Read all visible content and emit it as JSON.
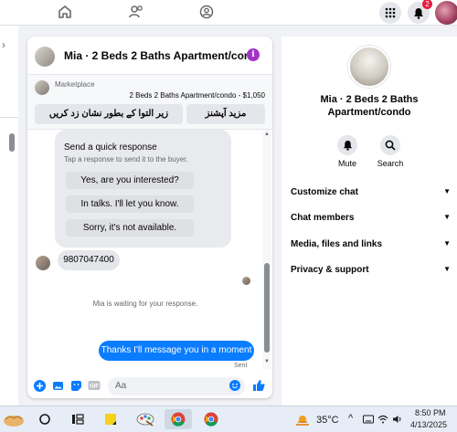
{
  "chat": {
    "title": "Mia · 2 Beds 2 Baths Apartment/condo...",
    "info_icon": "i",
    "marketplace": {
      "label": "Marketplace",
      "item": "2 Beds 2 Baths Apartment/condo - $1,050",
      "btn_more": "مزید آپشنز",
      "btn_pending": "زیر التوا کے بطور نشان زد کریں"
    },
    "quick_response": {
      "title": "Send a quick response",
      "subtitle": "Tap a response to send it to the buyer.",
      "options": [
        "Yes, are you interested?",
        "In talks. I'll let you know.",
        "Sorry, it's not available."
      ]
    },
    "incoming_message": "9807047400",
    "waiting_text": "Mia is waiting for your response.",
    "outgoing_message": "Thanks I'll message you in a moment",
    "sent_status": "Sent",
    "composer_placeholder": "Aa"
  },
  "details": {
    "name": "Mia · 2 Beds 2 Baths Apartment/condo",
    "actions": [
      "Mute",
      "Search"
    ],
    "sections": [
      "Customize chat",
      "Chat members",
      "Media, files and links",
      "Privacy & support"
    ]
  },
  "nav": {
    "notification_count": "2"
  },
  "taskbar": {
    "temperature": "35°C",
    "time": "8:50 PM",
    "date": "4/13/2025"
  },
  "colors": {
    "accent": "#0a7cff",
    "info": "#a333c8",
    "badge": "#e41e3f"
  }
}
